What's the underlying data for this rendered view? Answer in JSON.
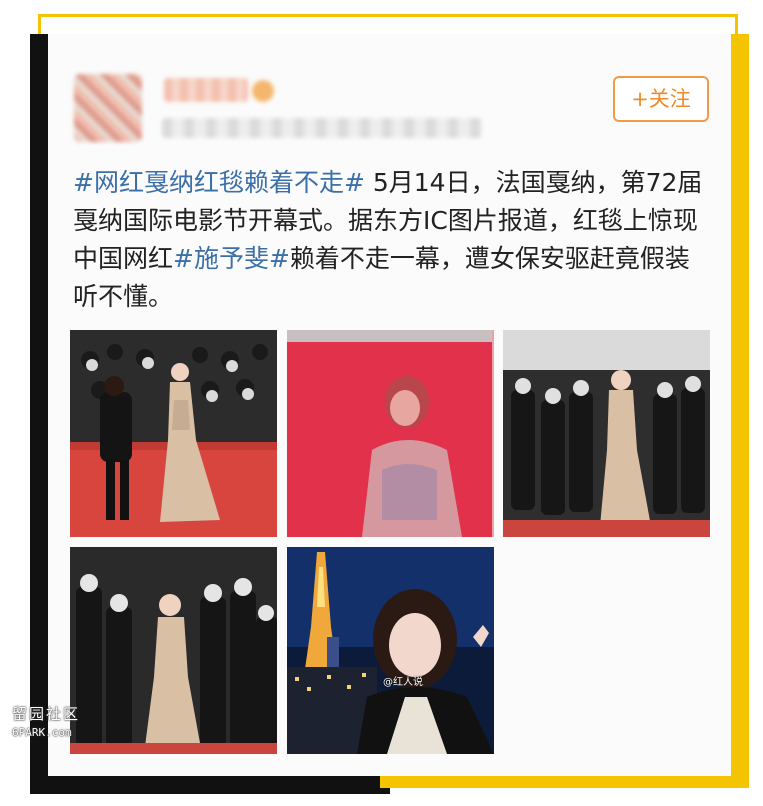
{
  "post": {
    "follow_label": "+关注",
    "text": {
      "hashtag1": "#网红戛纳红毯赖着不走#",
      "part1": " 5月14日，法国戛纳，第72届戛纳国际电影节开幕式。据东方IC图片报道，红毯上惊现中国网红",
      "hashtag2": "#施予斐#",
      "part2": "赖着不走一幕，遭女保安驱赶竟假装听不懂。"
    },
    "photos": [
      {
        "subject": "red carpet with woman security guard"
      },
      {
        "subject": "blurred close-up on red backdrop"
      },
      {
        "subject": "red carpet with photographers"
      },
      {
        "subject": "red carpet with photographers"
      },
      {
        "subject": "selfie with Tokyo Tower at night",
        "credit": "@红人说"
      }
    ]
  },
  "watermark": {
    "site_name": "留园社区",
    "site_url": "6PARK.com"
  },
  "colors": {
    "accent_yellow": "#f5c400",
    "frame_black": "#111111",
    "hashtag_blue": "#3b6fa8",
    "follow_orange": "#f08a2a"
  }
}
